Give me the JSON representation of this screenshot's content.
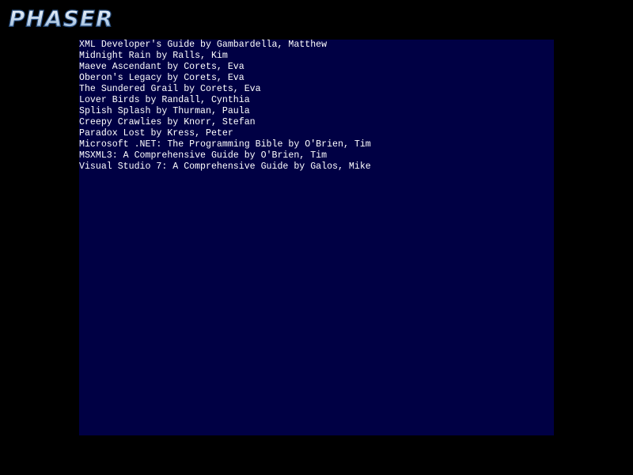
{
  "colors": {
    "background": "#000000",
    "panel": "#000044",
    "text": "#ffffff",
    "logo_fill_top": "#ffffff",
    "logo_fill_bottom": "#8fb3d9",
    "logo_outline": "#2a4f7f"
  },
  "logo": {
    "text": "PHASER"
  },
  "books": [
    {
      "text": "XML Developer's Guide by Gambardella, Matthew"
    },
    {
      "text": "Midnight Rain by Ralls, Kim"
    },
    {
      "text": "Maeve Ascendant by Corets, Eva"
    },
    {
      "text": "Oberon's Legacy by Corets, Eva"
    },
    {
      "text": "The Sundered Grail by Corets, Eva"
    },
    {
      "text": "Lover Birds by Randall, Cynthia"
    },
    {
      "text": "Splish Splash by Thurman, Paula"
    },
    {
      "text": "Creepy Crawlies by Knorr, Stefan"
    },
    {
      "text": "Paradox Lost by Kress, Peter"
    },
    {
      "text": "Microsoft .NET: The Programming Bible by O'Brien, Tim"
    },
    {
      "text": "MSXML3: A Comprehensive Guide by O'Brien, Tim"
    },
    {
      "text": "Visual Studio 7: A Comprehensive Guide by Galos, Mike"
    }
  ]
}
